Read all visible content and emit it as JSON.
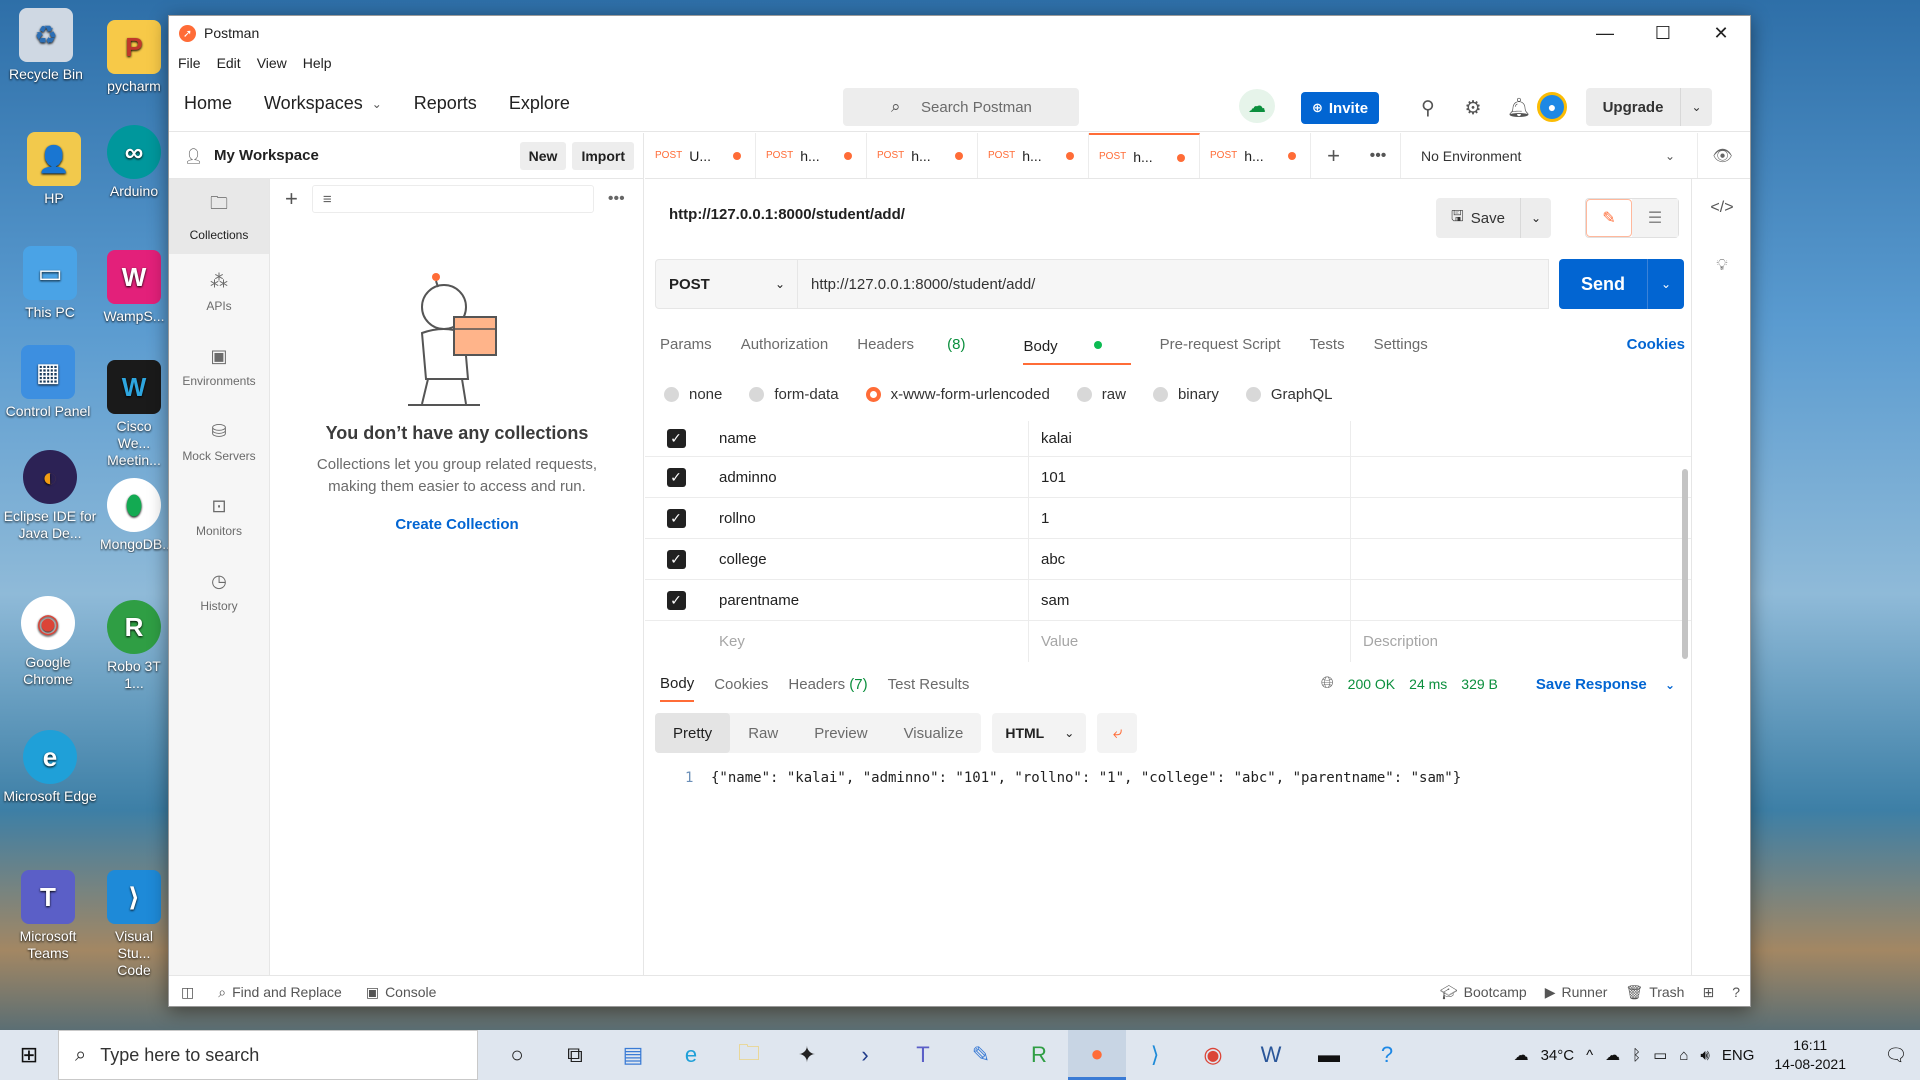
{
  "desktop": {
    "icons": [
      {
        "name": "recycle-bin-icon",
        "label": "Recycle Bin"
      },
      {
        "name": "hp-icon",
        "label": "HP"
      },
      {
        "name": "this-pc-icon",
        "label": "This PC"
      },
      {
        "name": "control-panel-icon",
        "label": "Control Panel"
      },
      {
        "name": "eclipse-icon",
        "label": "Eclipse IDE for Java De..."
      },
      {
        "name": "chrome-icon",
        "label": "Google Chrome"
      },
      {
        "name": "edge-icon",
        "label": "Microsoft Edge"
      },
      {
        "name": "teams-icon",
        "label": "Microsoft Teams"
      }
    ],
    "icons2": [
      {
        "name": "pycharm-icon",
        "label": "pycharm"
      },
      {
        "name": "arduino-icon",
        "label": "Arduino"
      },
      {
        "name": "wampserver-icon",
        "label": "WampS..."
      },
      {
        "name": "cisco-webex-icon",
        "label": "Cisco We... Meetin..."
      },
      {
        "name": "mongodb-icon",
        "label": "MongoDB..."
      },
      {
        "name": "robo3t-icon",
        "label": "Robo 3T 1..."
      },
      {
        "name": "vscode-icon",
        "label": "Visual Stu... Code"
      }
    ]
  },
  "window": {
    "title": "Postman",
    "controls": {
      "minimize": "—",
      "maximize": "☐",
      "close": "✕"
    }
  },
  "menu": [
    "File",
    "Edit",
    "View",
    "Help"
  ],
  "header": {
    "nav": [
      "Home",
      "Workspaces",
      "Reports",
      "Explore"
    ],
    "search_placeholder": "Search Postman",
    "invite": "Invite",
    "upgrade": "Upgrade"
  },
  "workspace": {
    "name": "My Workspace",
    "new": "New",
    "import": "Import"
  },
  "rail": [
    "Collections",
    "APIs",
    "Environments",
    "Mock Servers",
    "Monitors",
    "History"
  ],
  "collections_empty": {
    "title": "You don’t have any collections",
    "line1": "Collections let you group related requests,",
    "line2": "making them easier to access and run.",
    "cta": "Create Collection"
  },
  "tabs": [
    {
      "method": "POST",
      "label": "U..."
    },
    {
      "method": "POST",
      "label": "h..."
    },
    {
      "method": "POST",
      "label": "h..."
    },
    {
      "method": "POST",
      "label": "h..."
    },
    {
      "method": "POST",
      "label": "h..."
    },
    {
      "method": "POST",
      "label": "h..."
    }
  ],
  "environment": "No Environment",
  "request": {
    "name": "http://127.0.0.1:8000/student/add/",
    "save": "Save",
    "method": "POST",
    "url": "http://127.0.0.1:8000/student/add/",
    "send": "Send"
  },
  "request_tabs": {
    "params": "Params",
    "authorization": "Authorization",
    "headers": "Headers",
    "headers_count": "(8)",
    "body": "Body",
    "prerequest": "Pre-request Script",
    "tests": "Tests",
    "settings": "Settings",
    "cookies": "Cookies"
  },
  "body_types": [
    "none",
    "form-data",
    "x-www-form-urlencoded",
    "raw",
    "binary",
    "GraphQL"
  ],
  "kv_rows": [
    {
      "key": "name",
      "value": "kalai"
    },
    {
      "key": "adminno",
      "value": "101"
    },
    {
      "key": "rollno",
      "value": "1"
    },
    {
      "key": "college",
      "value": "abc"
    },
    {
      "key": "parentname",
      "value": "sam"
    }
  ],
  "kv_placeholder": {
    "key": "Key",
    "value": "Value",
    "description": "Description"
  },
  "response": {
    "tabs": {
      "body": "Body",
      "cookies": "Cookies",
      "headers": "Headers",
      "headers_count": "(7)",
      "tests": "Test Results"
    },
    "status": "200 OK",
    "time": "24 ms",
    "size": "329 B",
    "save_response": "Save Response",
    "views": [
      "Pretty",
      "Raw",
      "Preview",
      "Visualize"
    ],
    "format": "HTML",
    "line_no": "1",
    "body": "{\"name\": \"kalai\", \"adminno\": \"101\", \"rollno\": \"1\", \"college\": \"abc\", \"parentname\": \"sam\"}"
  },
  "footer": {
    "find": "Find and Replace",
    "console": "Console",
    "bootcamp": "Bootcamp",
    "runner": "Runner",
    "trash": "Trash"
  },
  "taskbar": {
    "search_placeholder": "Type here to search",
    "temp": "34°C",
    "lang": "ENG",
    "time": "16:11",
    "date": "14-08-2021"
  }
}
